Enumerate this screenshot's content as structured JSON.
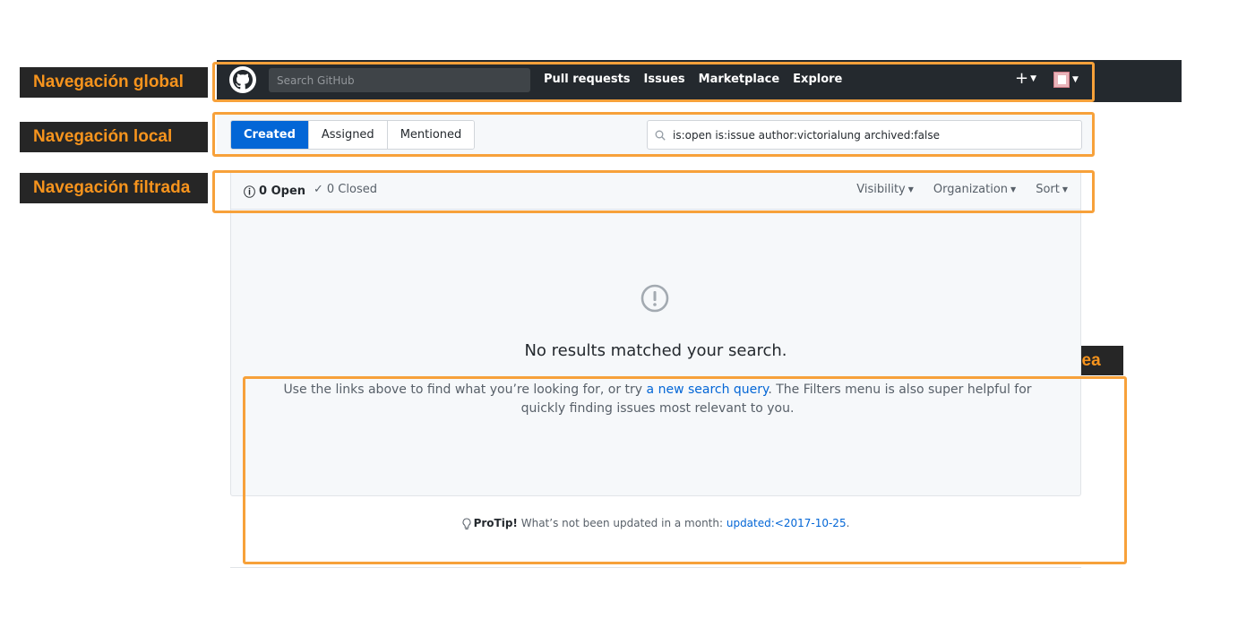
{
  "annotations": {
    "global": "Navegación global",
    "local": "Navegación local",
    "filtered": "Navegación filtrada",
    "inline": "Navegación en línea"
  },
  "header": {
    "search_placeholder": "Search GitHub",
    "nav": [
      "Pull requests",
      "Issues",
      "Marketplace",
      "Explore"
    ],
    "plus": "+"
  },
  "local_nav": {
    "tabs": [
      {
        "label": "Created",
        "active": true
      },
      {
        "label": "Assigned",
        "active": false
      },
      {
        "label": "Mentioned",
        "active": false
      }
    ],
    "search_value": "is:open is:issue author:victorialung archived:false"
  },
  "filters": {
    "open": "0 Open",
    "closed": "0 Closed",
    "menus": [
      "Visibility",
      "Organization",
      "Sort"
    ]
  },
  "blankslate": {
    "title": "No results matched your search.",
    "desc_before": "Use the links above to find what you’re looking for, or try ",
    "desc_link": "a new search query",
    "desc_after": ". The Filters menu is also super helpful for quickly finding issues most relevant to you."
  },
  "protip": {
    "label": "ProTip!",
    "text": " What’s not been updated in a month: ",
    "link": "updated:<2017-10-25",
    "end": "."
  },
  "colors": {
    "header_bg": "#24292e",
    "accent_blue": "#0366d6",
    "annotation_orange": "#f7a13a",
    "tag_text": "#f7941d"
  }
}
